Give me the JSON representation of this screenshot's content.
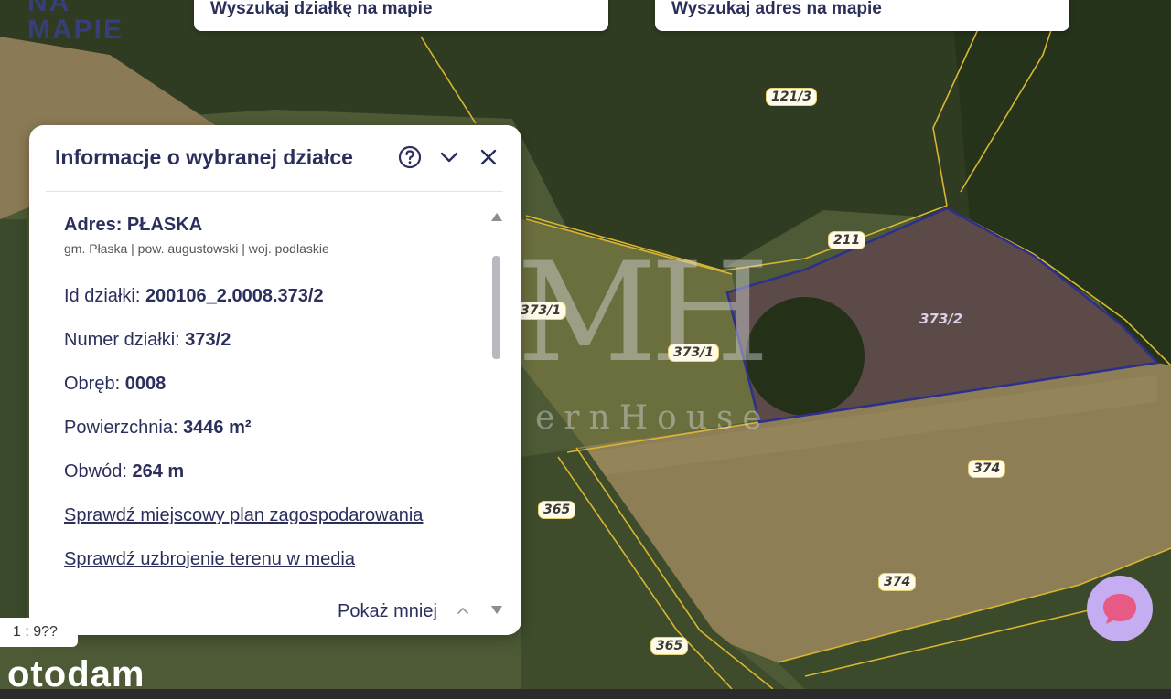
{
  "search": {
    "parcel_label": "Wyszukaj działkę na mapie",
    "address_label": "Wyszukaj adres na mapie"
  },
  "logo": {
    "line1": "NA",
    "line2": "MAPIE"
  },
  "panel": {
    "title": "Informacje o wybranej działce",
    "address": "Adres: PŁASKA",
    "address_detail": "gm. Płaska | pow. augustowski | woj. podlaskie",
    "fields": [
      {
        "label": "Id działki: ",
        "value": "200106_2.0008.373/2"
      },
      {
        "label": "Numer działki: ",
        "value": "373/2"
      },
      {
        "label": "Obręb: ",
        "value": "0008"
      },
      {
        "label": "Powierzchnia: ",
        "value": "3446 m²"
      },
      {
        "label": "Obwód: ",
        "value": "264 m"
      }
    ],
    "links": [
      "Sprawdź miejscowy plan zagospodarowania",
      "Sprawdź uzbrojenie terenu w media"
    ],
    "show_less": "Pokaż mniej"
  },
  "map": {
    "parcels": [
      "121/3",
      "211",
      "373/1",
      "373/1",
      "373/2",
      "374",
      "374",
      "365",
      "365"
    ],
    "scale": "1 : 9??",
    "watermark_logo": "MH",
    "watermark_text": "ernHouse",
    "colors": {
      "parcel_lines": "#d8b632",
      "selected_outline": "#2d2f8f"
    }
  },
  "brand": "otodam",
  "icons": [
    "help-icon",
    "chevron-down-icon",
    "close-icon",
    "chevron-up-icon",
    "chat-icon"
  ]
}
